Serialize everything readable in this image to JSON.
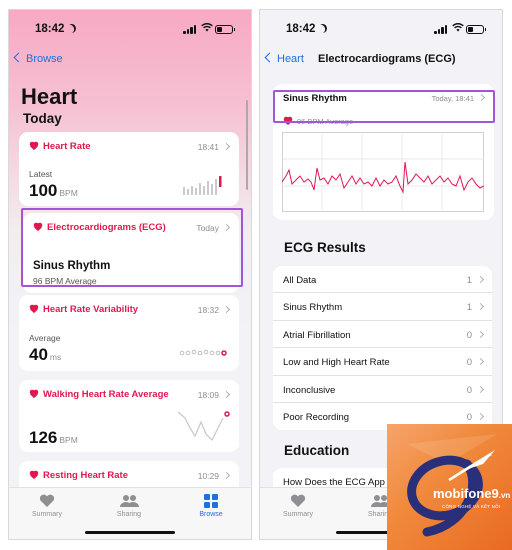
{
  "left": {
    "status_time": "18:42",
    "back_label": "Browse",
    "title": "Heart",
    "section": "Today",
    "cards": {
      "heart_rate": {
        "title": "Heart Rate",
        "time": "18:41",
        "caption": "Latest",
        "value": "100",
        "unit": "BPM"
      },
      "ecg": {
        "title": "Electrocardiograms (ECG)",
        "time": "Today",
        "result": "Sinus Rhythm",
        "sub": "96 BPM Average"
      },
      "hrv": {
        "title": "Heart Rate Variability",
        "time": "18:32",
        "caption": "Average",
        "value": "40",
        "unit": "ms"
      },
      "walking": {
        "title": "Walking Heart Rate Average",
        "time": "18:09",
        "value": "126",
        "unit": "BPM"
      },
      "resting": {
        "title": "Resting Heart Rate",
        "time": "10:29"
      }
    },
    "tabs": [
      "Summary",
      "Sharing",
      "Browse"
    ]
  },
  "right": {
    "status_time": "18:42",
    "back_label": "Heart",
    "nav_title": "Electrocardiograms (ECG)",
    "ecg_result": "Sinus Rhythm",
    "ecg_time": "Today, 18:41",
    "ecg_avg": "96 BPM Average",
    "results_title": "ECG Results",
    "results": [
      {
        "label": "All Data",
        "count": "1"
      },
      {
        "label": "Sinus Rhythm",
        "count": "1"
      },
      {
        "label": "Atrial Fibrillation",
        "count": "0"
      },
      {
        "label": "Low and High Heart Rate",
        "count": "0"
      },
      {
        "label": "Inconclusive",
        "count": "0"
      },
      {
        "label": "Poor Recording",
        "count": "0"
      }
    ],
    "education_title": "Education",
    "education_item": "How Does the ECG App Wo",
    "tabs": [
      "Summary",
      "Sharing"
    ]
  },
  "watermark": {
    "brand": "mobifone9",
    "domain": ".vn",
    "tagline": "CÔNG NGHỆ VÀ KẾT NỐI"
  },
  "colors": {
    "accent": "#1f6fe0",
    "heart_red": "#e0184f",
    "highlight": "#a355d9",
    "watermark_orange": "#ee7a2e"
  }
}
